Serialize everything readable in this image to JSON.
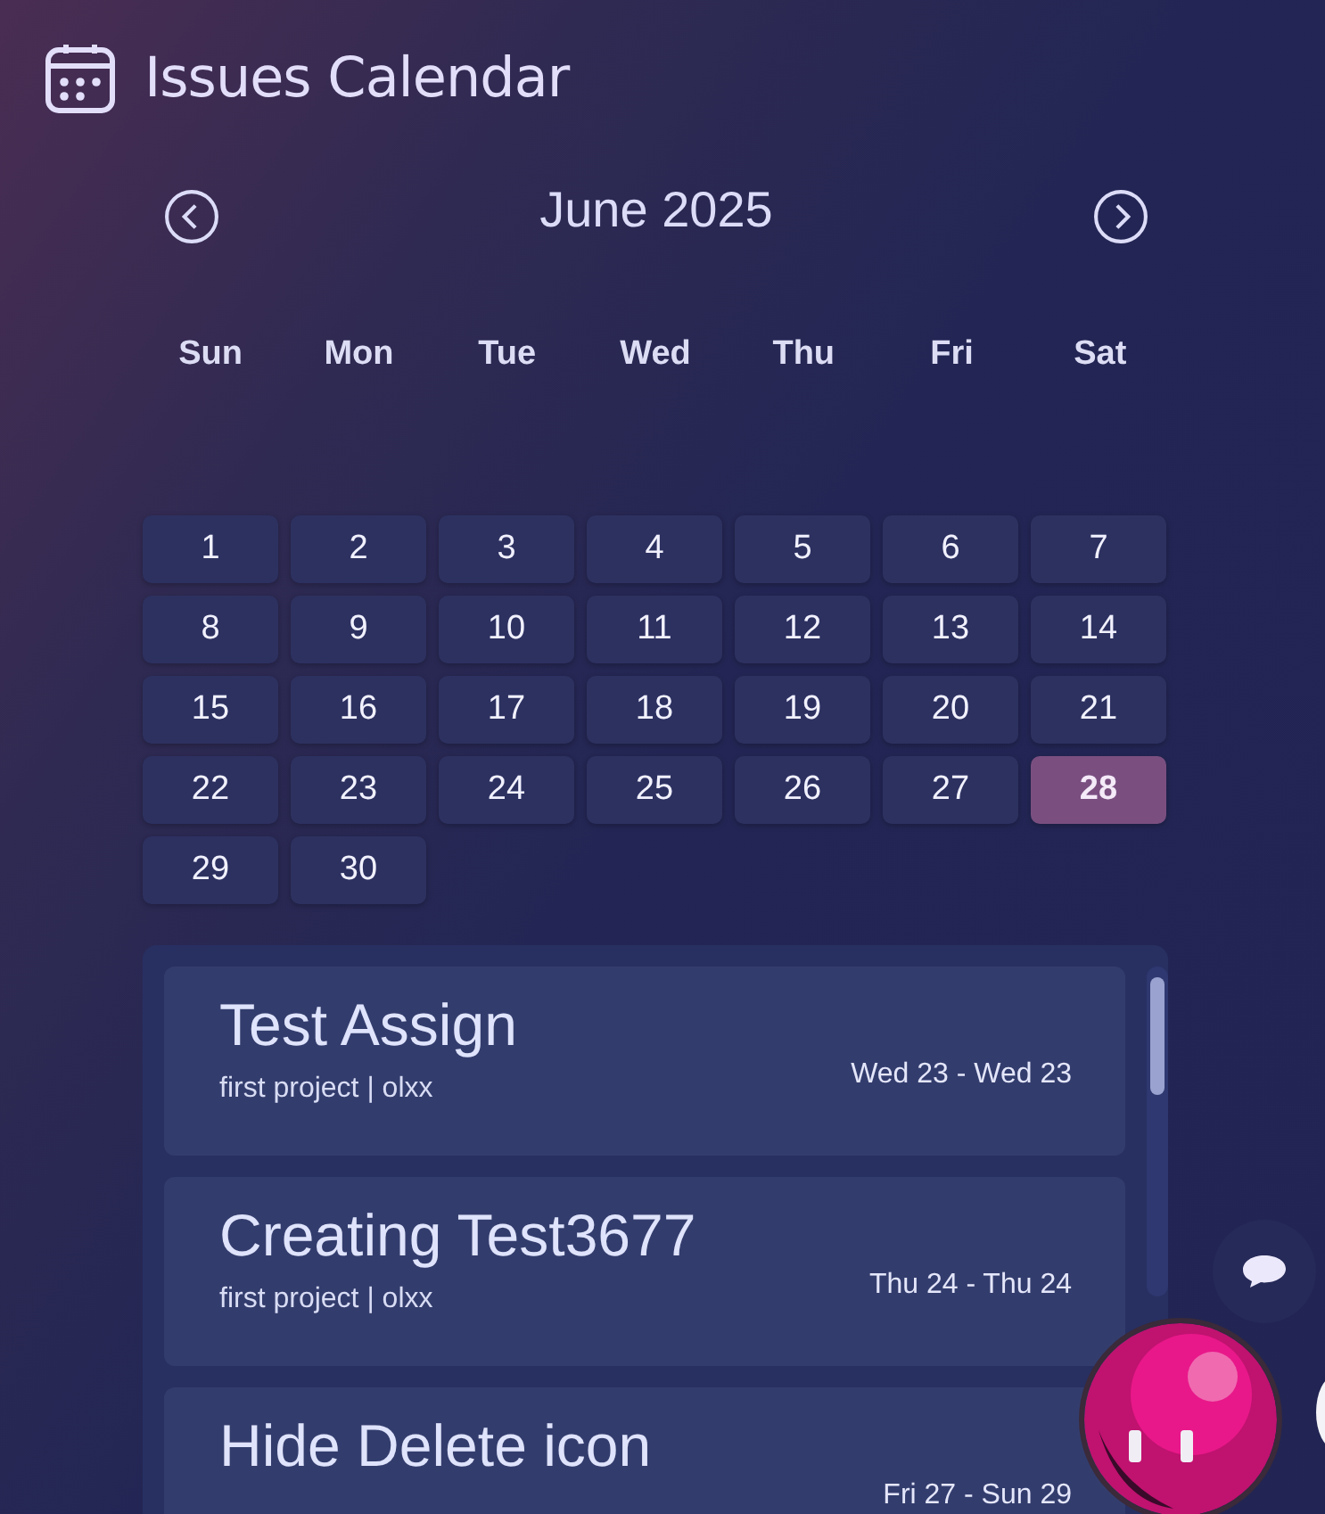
{
  "header": {
    "title": "Issues Calendar"
  },
  "calendar": {
    "month": "June 2025",
    "weekdays": [
      "Sun",
      "Mon",
      "Tue",
      "Wed",
      "Thu",
      "Fri",
      "Sat"
    ],
    "days": [
      {
        "label": "1",
        "selected": false
      },
      {
        "label": "2",
        "selected": false
      },
      {
        "label": "3",
        "selected": false
      },
      {
        "label": "4",
        "selected": false
      },
      {
        "label": "5",
        "selected": false
      },
      {
        "label": "6",
        "selected": false
      },
      {
        "label": "7",
        "selected": false
      },
      {
        "label": "8",
        "selected": false
      },
      {
        "label": "9",
        "selected": false
      },
      {
        "label": "10",
        "selected": false
      },
      {
        "label": "11",
        "selected": false
      },
      {
        "label": "12",
        "selected": false
      },
      {
        "label": "13",
        "selected": false
      },
      {
        "label": "14",
        "selected": false
      },
      {
        "label": "15",
        "selected": false
      },
      {
        "label": "16",
        "selected": false
      },
      {
        "label": "17",
        "selected": false
      },
      {
        "label": "18",
        "selected": false
      },
      {
        "label": "19",
        "selected": false
      },
      {
        "label": "20",
        "selected": false
      },
      {
        "label": "21",
        "selected": false
      },
      {
        "label": "22",
        "selected": false
      },
      {
        "label": "23",
        "selected": false
      },
      {
        "label": "24",
        "selected": false
      },
      {
        "label": "25",
        "selected": false
      },
      {
        "label": "26",
        "selected": false
      },
      {
        "label": "27",
        "selected": false
      },
      {
        "label": "28",
        "selected": true
      },
      {
        "label": "29",
        "selected": false
      },
      {
        "label": "30",
        "selected": false
      }
    ]
  },
  "issues": [
    {
      "title": "Test Assign",
      "meta": "first project | olxx",
      "range": "Wed 23 - Wed 23"
    },
    {
      "title": "Creating Test3677",
      "meta": "first project | olxx",
      "range": "Thu 24 - Thu 24"
    },
    {
      "title": "Hide Delete icon",
      "range": "Fri 27 - Sun 29"
    }
  ]
}
